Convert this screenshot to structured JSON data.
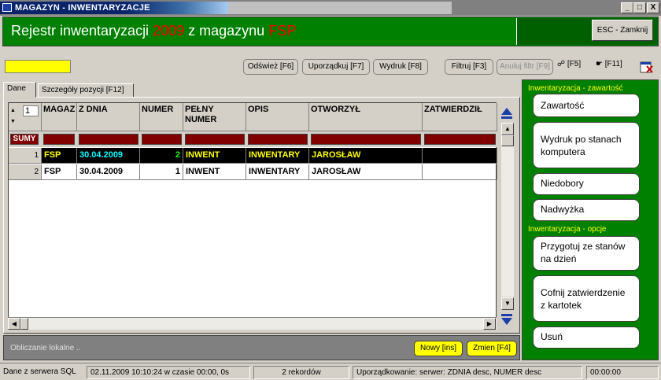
{
  "window": {
    "title": "MAGAZYN - INWENTARYZACJE",
    "controls": [
      "_",
      "□",
      "X"
    ]
  },
  "header": {
    "label": "Rejestr  inwentaryzacji",
    "year": "2009",
    "mid": "z  magazynu",
    "warehouse": "FSP",
    "close_label": "ESC - Zamknij"
  },
  "toolbar": {
    "refresh": "Odśwież [F6]",
    "sort": "Uporządkuj [F7]",
    "print": "Wydruk [F8]",
    "filter": "Filtruj [F3]",
    "cancel_filter": "Anuluj filtr [F9]",
    "f5": "[F5]",
    "f11": "[F11]"
  },
  "tabs": [
    "Dane",
    "Szczegóły pozycji [F12]"
  ],
  "grid": {
    "counter": "1",
    "columns": [
      "MAGAZ",
      "Z DNIA",
      "NUMER",
      "PEŁNY NUMER",
      "OPIS",
      "OTWORZYŁ",
      "ZATWIERDZIŁ"
    ],
    "sums_label": "SUMY",
    "rows": [
      {
        "n": "1",
        "mag": "FSP",
        "date": "30.04.2009",
        "num": "2",
        "full": "INWENT",
        "opis": "INWENTARY",
        "otw": "JAROSŁAW",
        "zatw": ""
      },
      {
        "n": "2",
        "mag": "FSP",
        "date": "30.04.2009",
        "num": "1",
        "full": "INWENT",
        "opis": "INWENTARY",
        "otw": "JAROSŁAW",
        "zatw": ""
      }
    ]
  },
  "status_panel": {
    "text": "Obliczanie lokalne ..",
    "new": "Nowy [ins]",
    "edit": "Zmien [F4]"
  },
  "side": {
    "section1": "Inwentaryzacja - zawartość",
    "contents": "Zawartość",
    "print_stock": "Wydruk po stanach komputera",
    "shortages": "Niedobory",
    "surplus": "Nadwyżka",
    "section2": "Inwentaryzacja - opcje",
    "prepare": "Przygotuj ze stanów na dzień",
    "revert": "Cofnij zatwierdzenie z kartotek",
    "delete": "Usuń"
  },
  "statusbar": {
    "source": "Dane z serwera SQL",
    "time": "02.11.2009 10:10:24 w czasie 00:00, 0s",
    "records": "2 rekordów",
    "order": "Uporządkowanie:  serwer: ZDNIA desc, NUMER desc",
    "clock": "00:00:00"
  },
  "colors": {
    "header_green": "#008000",
    "accent_red": "#ff0000",
    "selection_bg": "#000000",
    "highlight_yellow": "#ffff00"
  }
}
